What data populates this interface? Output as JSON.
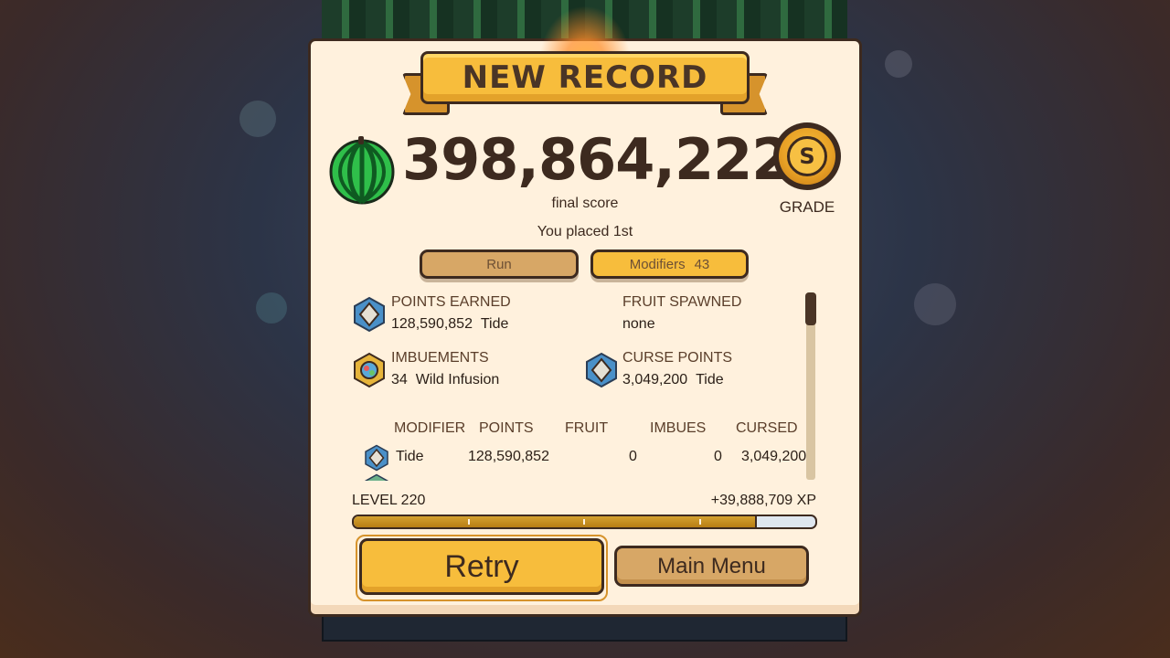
{
  "banner": {
    "title": "NEW RECORD"
  },
  "result": {
    "score": "398,864,222",
    "score_label": "final score",
    "grade": "S",
    "grade_label": "GRADE",
    "placement": "You placed 1st"
  },
  "tabs": [
    {
      "label": "Run",
      "count": ""
    },
    {
      "label": "Modifiers",
      "count": "43"
    }
  ],
  "stats": [
    {
      "title": "POINTS EARNED",
      "value": "128,590,852",
      "detail": "Tide",
      "icon": "tide-diamond-icon"
    },
    {
      "title": "FRUIT SPAWNED",
      "value": "none",
      "detail": "",
      "icon": ""
    },
    {
      "title": "IMBUEMENTS",
      "value": "34",
      "detail": "Wild Infusion",
      "icon": "wild-infusion-icon"
    },
    {
      "title": "CURSE POINTS",
      "value": "3,049,200",
      "detail": "Tide",
      "icon": "tide-diamond-icon"
    }
  ],
  "table": {
    "headers": [
      "MODIFIER",
      "POINTS",
      "FRUIT",
      "IMBUES",
      "CURSED"
    ],
    "rows": [
      {
        "modifier": "Tide",
        "points": "128,590,852",
        "fruit": "0",
        "imbues": "0",
        "cursed": "3,049,200"
      }
    ]
  },
  "progress": {
    "level": "LEVEL 220",
    "xp_gain": "+39,888,709 XP",
    "fill_fraction": 0.87
  },
  "buttons": {
    "retry": "Retry",
    "main_menu": "Main Menu"
  },
  "colors": {
    "accent": "#f7bd3c",
    "secondary_button": "#d7a766",
    "panel": "#fff1dd",
    "outline": "#3d2a1f"
  }
}
